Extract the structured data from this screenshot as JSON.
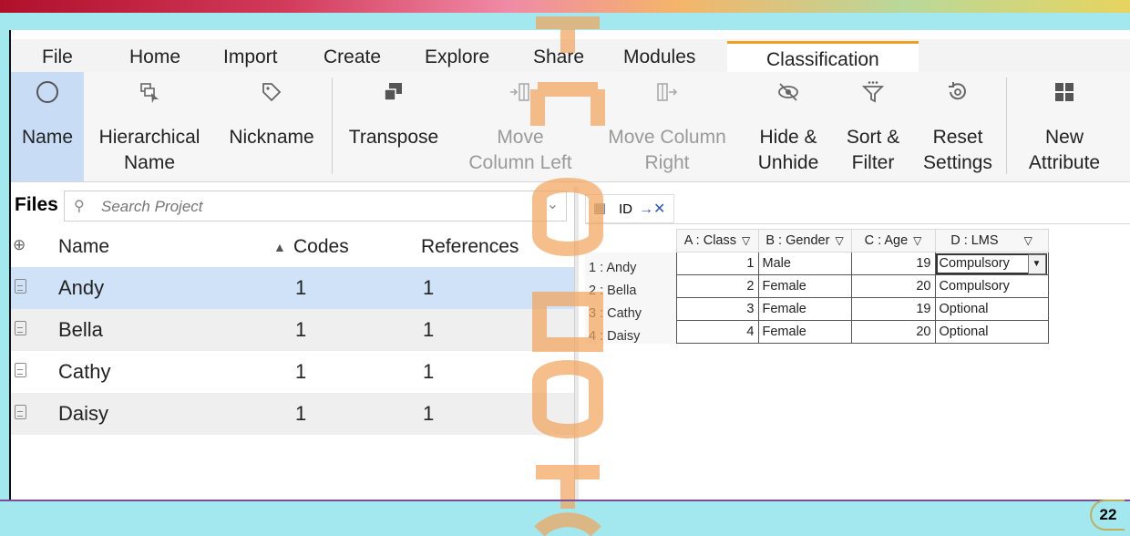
{
  "ribbon_tabs": [
    "File",
    "Home",
    "Import",
    "Create",
    "Explore",
    "Share",
    "Modules",
    "Classification"
  ],
  "ribbon": {
    "name": {
      "line1": "Name",
      "line2": ""
    },
    "hier": {
      "line1": "Hierarchical",
      "line2": "Name"
    },
    "nick": {
      "line1": "Nickname",
      "line2": ""
    },
    "transpose": {
      "line1": "Transpose",
      "line2": ""
    },
    "moveleft": {
      "line1": "Move",
      "line2": "Column Left"
    },
    "moveright": {
      "line1": "Move Column",
      "line2": "Right"
    },
    "hide": {
      "line1": "Hide &",
      "line2": "Unhide"
    },
    "sort": {
      "line1": "Sort &",
      "line2": "Filter"
    },
    "reset": {
      "line1": "Reset",
      "line2": "Settings"
    },
    "newattr": {
      "line1": "New",
      "line2": "Attribute"
    }
  },
  "files": {
    "title": "Files",
    "search_placeholder": "Search Project",
    "columns": {
      "name": "Name",
      "codes": "Codes",
      "references": "References"
    },
    "rows": [
      {
        "name": "Andy",
        "codes": "1",
        "references": "1"
      },
      {
        "name": "Bella",
        "codes": "1",
        "references": "1"
      },
      {
        "name": "Cathy",
        "codes": "1",
        "references": "1"
      },
      {
        "name": "Daisy",
        "codes": "1",
        "references": "1"
      }
    ]
  },
  "classification": {
    "tab_label": "ID",
    "headers": [
      "A : Class",
      "B : Gender",
      "C : Age",
      "D : LMS"
    ],
    "rows": [
      {
        "label": "1 : Andy",
        "class": "1",
        "gender": "Male",
        "age": "19",
        "lms": "Compulsory"
      },
      {
        "label": "2 : Bella",
        "class": "2",
        "gender": "Female",
        "age": "20",
        "lms": "Compulsory"
      },
      {
        "label": "3 : Cathy",
        "class": "3",
        "gender": "Female",
        "age": "19",
        "lms": "Optional"
      },
      {
        "label": "4 : Daisy",
        "class": "4",
        "gender": "Female",
        "age": "20",
        "lms": "Optional"
      }
    ]
  },
  "page_number": "22",
  "colors": {
    "accent_tab": "#f0a020",
    "selection": "#cfe2f7",
    "background": "#a4e8ef",
    "watermark": "#f2a25a"
  }
}
